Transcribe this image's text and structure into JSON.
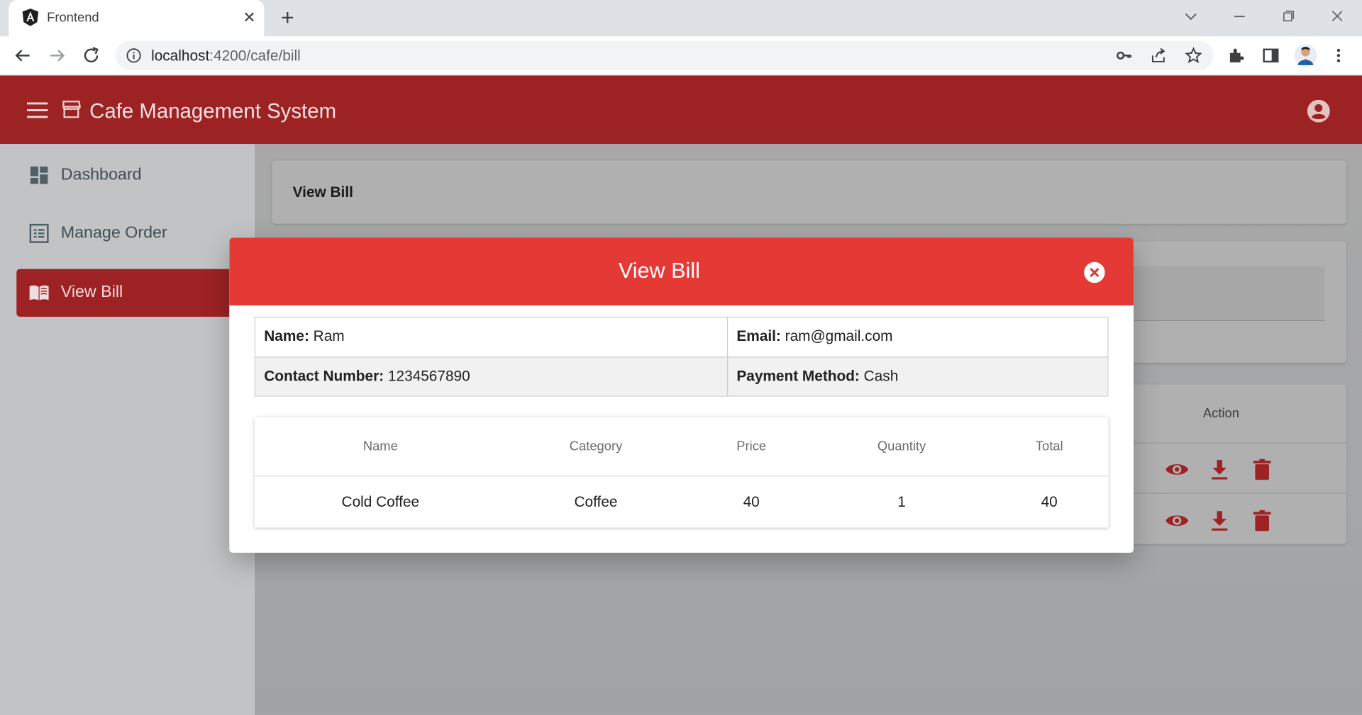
{
  "browser": {
    "tab_title": "Frontend",
    "url_host": "localhost",
    "url_rest": ":4200/cafe/bill",
    "tab_close": "✕",
    "new_tab": "+"
  },
  "app": {
    "title": "Cafe Management System",
    "accent_color": "#9d2224"
  },
  "sidebar": {
    "items": [
      {
        "label": "Dashboard",
        "icon": "dashboard-icon"
      },
      {
        "label": "Manage Order",
        "icon": "list-icon"
      },
      {
        "label": "View Bill",
        "icon": "book-icon",
        "active": true
      }
    ]
  },
  "page": {
    "card_title": "View Bill",
    "table_action_header": "Action"
  },
  "dialog": {
    "title": "View Bill",
    "name_label": "Name:",
    "name_value": "Ram",
    "email_label": "Email:",
    "email_value": "ram@gmail.com",
    "contact_label": "Contact Number:",
    "contact_value": "1234567890",
    "payment_label": "Payment Method:",
    "payment_value": "Cash",
    "columns": [
      "Name",
      "Category",
      "Price",
      "Quantity",
      "Total"
    ],
    "rows": [
      {
        "name": "Cold Coffee",
        "category": "Coffee",
        "price": "40",
        "quantity": "1",
        "total": "40"
      }
    ],
    "header_color": "#e53935"
  }
}
